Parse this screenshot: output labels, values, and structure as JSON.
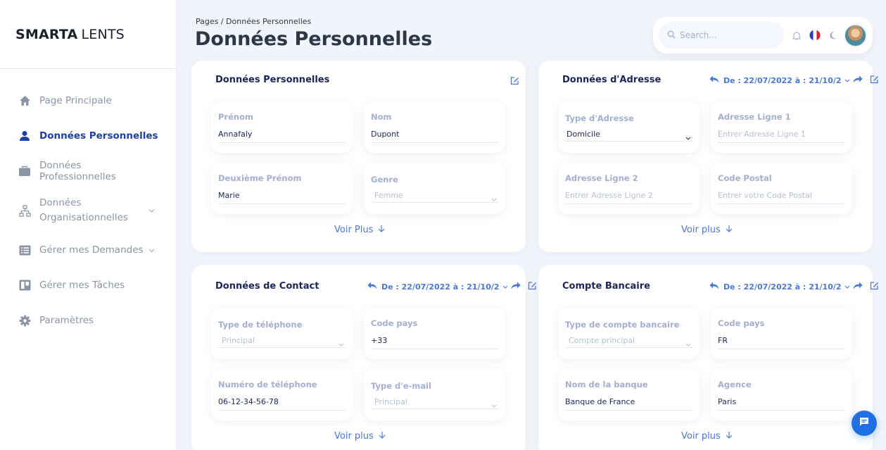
{
  "brand": {
    "bold": "SMARTA",
    "light": "LENTS"
  },
  "sidebar": {
    "items": [
      {
        "label": "Page Principale",
        "icon": "home-icon"
      },
      {
        "label": "Données Personnelles",
        "icon": "user-icon",
        "active": true
      },
      {
        "label": "Données Professionnelles",
        "icon": "briefcase-icon"
      },
      {
        "label_line1": "Données",
        "label_line2": "Organisationnelles",
        "icon": "org-chart-icon",
        "expandable": true
      },
      {
        "label": "Gérer mes Demandes",
        "icon": "list-icon",
        "expandable": true
      },
      {
        "label": "Gérer mes Tâches",
        "icon": "board-icon"
      },
      {
        "label": "Paramètres",
        "icon": "gear-icon"
      }
    ]
  },
  "header": {
    "breadcrumb": "Pages  /  Données Personnelles",
    "title": "Données Personnelles",
    "search_placeholder": "Search..."
  },
  "cards": {
    "personal": {
      "title": "Données Personnelles",
      "fields": [
        {
          "label": "Prénom",
          "value": "Annafaly"
        },
        {
          "label": "Nom",
          "value": "Dupont"
        },
        {
          "label": "Deuxième Prénom",
          "value": "Marie"
        },
        {
          "label": "Genre",
          "value": "Femme"
        }
      ],
      "more": "Voir Plus"
    },
    "address": {
      "title": "Données d'Adresse",
      "date_range": "De : 22/07/2022 à : 21/10/2",
      "fields": [
        {
          "label": "Type d'Adresse",
          "value": "Domicile"
        },
        {
          "label": "Adresse Ligne 1",
          "value": "Entrer Adresse Ligne 1"
        },
        {
          "label": "Adresse Ligne 2",
          "value": "Entrer Adresse Ligne 2"
        },
        {
          "label": "Code Postal",
          "value": "Entrer votre Code Postal"
        }
      ],
      "more": "Voir plus"
    },
    "contact": {
      "title": "Données de Contact",
      "date_range": "De : 22/07/2022 à : 21/10/2",
      "fields": [
        {
          "label": "Type de téléphone",
          "value": "Principal"
        },
        {
          "label": "Code pays",
          "value": "+33"
        },
        {
          "label": "Numéro de téléphone",
          "value": "06-12-34-56-78"
        },
        {
          "label": "Type d'e-mail",
          "value": "Principal"
        }
      ],
      "more": "Voir plus"
    },
    "bank": {
      "title": "Compte Bancaire",
      "date_range": "De : 22/07/2022 à : 21/10/2",
      "fields": [
        {
          "label": "Type de compte bancaire",
          "value": "Compte principal"
        },
        {
          "label": "Code pays",
          "value": "FR"
        },
        {
          "label": "Nom de la banque",
          "value": "Banque de France"
        },
        {
          "label": "Agence",
          "value": "Paris"
        }
      ],
      "more": "Voir plus"
    }
  },
  "colors": {
    "accent": "#4a78d6",
    "active_nav": "#1d3fa8",
    "chat_button": "#1f6fe5"
  }
}
